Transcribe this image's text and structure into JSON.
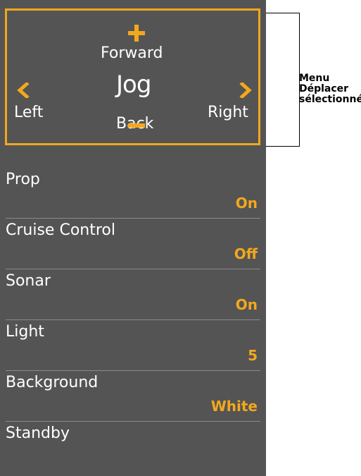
{
  "jog_control": {
    "forward_label": "Forward",
    "center_label": "Jog",
    "left_label": "Left",
    "right_label": "Right",
    "back_label": "Back",
    "accent_color": "#f2a81d"
  },
  "menu": {
    "items": [
      {
        "label": "Prop",
        "value": "On"
      },
      {
        "label": "Cruise Control",
        "value": "Off"
      },
      {
        "label": "Sonar",
        "value": "On"
      },
      {
        "label": "Light",
        "value": "5"
      },
      {
        "label": "Background",
        "value": "White"
      },
      {
        "label": "Standby",
        "value": ""
      }
    ]
  },
  "annotation": {
    "line1": "Menu",
    "line2": "Déplacer",
    "line3": "sélectionné"
  }
}
